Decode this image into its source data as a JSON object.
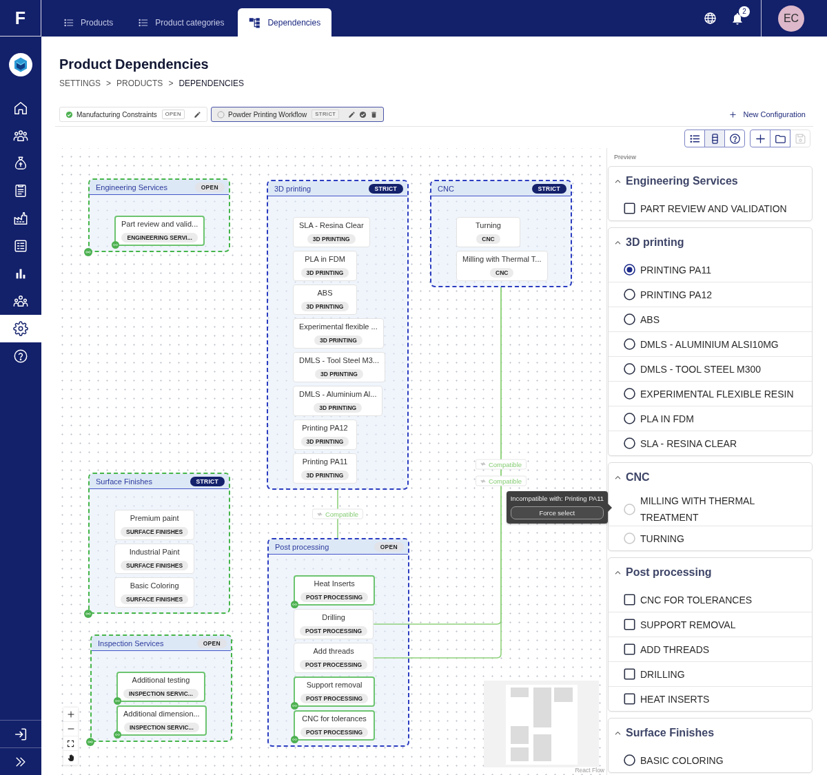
{
  "sidebar": {
    "brand": "F",
    "items": [
      {
        "selected": false
      },
      {
        "selected": false
      },
      {
        "selected": false
      },
      {
        "selected": false
      },
      {
        "selected": false
      },
      {
        "selected": false
      },
      {
        "selected": false
      },
      {
        "selected": false
      },
      {
        "selected": true
      },
      {
        "selected": false
      }
    ]
  },
  "topbar": {
    "tabs": [
      {
        "label": "Products",
        "selected": false
      },
      {
        "label": "Product categories",
        "selected": false
      },
      {
        "label": "Dependencies",
        "selected": true
      }
    ],
    "notifications": "2",
    "avatar": "EC"
  },
  "page": {
    "title": "Product Dependencies",
    "breadcrumb": [
      {
        "label": "SETTINGS",
        "current": false
      },
      {
        "label": "PRODUCTS",
        "separator": ">",
        "current": false
      },
      {
        "label": "DEPENDENCIES",
        "separator": ">",
        "current": true
      }
    ]
  },
  "configurations": {
    "items": [
      {
        "name": "Manufacturing Constraints",
        "mode": "OPEN",
        "active": true,
        "selected": false
      },
      {
        "name": "Powder Printing Workflow",
        "mode": "STRICT",
        "active": false,
        "selected": true
      }
    ],
    "new_configuration": "New Configuration"
  },
  "toolbar": {
    "views": [
      {
        "selected": false
      },
      {
        "selected": true
      },
      {
        "selected": false
      }
    ],
    "actions": [
      {
        "disabled": false
      },
      {
        "disabled": false
      },
      {
        "disabled": true
      }
    ]
  },
  "canvas": {
    "groups": [
      {
        "title": "Engineering Services",
        "mode": "OPEN",
        "strict": false,
        "color": "#45b549",
        "handle": true,
        "nodes": [
          {
            "name": "Part review and valid...",
            "category": "ENGINEERING SERVI...",
            "highlighted": true
          }
        ]
      },
      {
        "title": "3D printing",
        "mode": "STRICT",
        "strict": true,
        "color": "#2b3cc0",
        "handle": false,
        "nodes": [
          {
            "name": "SLA - Resina Clear",
            "category": "3D PRINTING",
            "highlighted": false
          },
          {
            "name": "PLA in FDM",
            "category": "3D PRINTING",
            "highlighted": false
          },
          {
            "name": "ABS",
            "category": "3D PRINTING",
            "highlighted": false
          },
          {
            "name": "Experimental flexible ...",
            "category": "3D PRINTING",
            "highlighted": false
          },
          {
            "name": "DMLS - Tool Steel M3...",
            "category": "3D PRINTING",
            "highlighted": false
          },
          {
            "name": "DMLS - Aluminium Al...",
            "category": "3D PRINTING",
            "highlighted": false
          },
          {
            "name": "Printing PA12",
            "category": "3D PRINTING",
            "highlighted": false
          },
          {
            "name": "Printing PA11",
            "category": "3D PRINTING",
            "highlighted": false
          }
        ]
      },
      {
        "title": "CNC",
        "mode": "STRICT",
        "strict": true,
        "color": "#2b3cc0",
        "handle": false,
        "nodes": [
          {
            "name": "Turning",
            "category": "CNC",
            "highlighted": false
          },
          {
            "name": "Milling with Thermal T...",
            "category": "CNC",
            "highlighted": false
          }
        ]
      },
      {
        "title": "Surface Finishes",
        "mode": "STRICT",
        "strict": true,
        "color": "#45b549",
        "handle": true,
        "nodes": [
          {
            "name": "Premium paint",
            "category": "SURFACE FINISHES",
            "highlighted": false
          },
          {
            "name": "Industrial Paint",
            "category": "SURFACE FINISHES",
            "highlighted": false
          },
          {
            "name": "Basic Coloring",
            "category": "SURFACE FINISHES",
            "highlighted": false
          }
        ]
      },
      {
        "title": "Inspection Services",
        "mode": "OPEN",
        "strict": false,
        "color": "#45b549",
        "handle": true,
        "nodes": [
          {
            "name": "Additional testing",
            "category": "INSPECTION SERVIC...",
            "highlighted": true
          },
          {
            "name": "Additional dimension...",
            "category": "INSPECTION SERVIC...",
            "highlighted": true
          }
        ]
      },
      {
        "title": "Post processing",
        "mode": "OPEN",
        "strict": false,
        "color": "#2b3cc0",
        "handle": false,
        "nodes": [
          {
            "name": "Heat Inserts",
            "category": "POST PROCESSING",
            "highlighted": true
          },
          {
            "name": "Drilling",
            "category": "POST PROCESSING",
            "highlighted": false
          },
          {
            "name": "Add threads",
            "category": "POST PROCESSING",
            "highlighted": false
          },
          {
            "name": "Support removal",
            "category": "POST PROCESSING",
            "highlighted": true
          },
          {
            "name": "CNC for tolerances",
            "category": "POST PROCESSING",
            "highlighted": true
          }
        ]
      }
    ],
    "edges": [
      {
        "label": "Compatible"
      },
      {
        "label": "Compatible"
      },
      {
        "label": "Compatible"
      }
    ],
    "attribution": "React Flow"
  },
  "preview": {
    "label": "Preview",
    "sections": [
      {
        "title": "Engineering Services",
        "expanded": true,
        "kind": "checkbox",
        "items": [
          {
            "label": "PART REVIEW AND VALIDATION",
            "checked": false
          }
        ]
      },
      {
        "title": "3D printing",
        "expanded": true,
        "kind": "radio",
        "items": [
          {
            "label": "PRINTING PA11",
            "selected": true
          },
          {
            "label": "PRINTING PA12",
            "selected": false
          },
          {
            "label": "ABS",
            "selected": false
          },
          {
            "label": "DMLS - ALUMINIUM ALSI10MG",
            "selected": false
          },
          {
            "label": "DMLS - TOOL STEEL M300",
            "selected": false
          },
          {
            "label": "EXPERIMENTAL FLEXIBLE RESIN",
            "selected": false
          },
          {
            "label": "PLA IN FDM",
            "selected": false
          },
          {
            "label": "SLA - RESINA CLEAR",
            "selected": false
          }
        ]
      },
      {
        "title": "CNC",
        "expanded": true,
        "kind": "radio",
        "items": [
          {
            "label": "MILLING WITH THERMAL TREATMENT",
            "selected": false,
            "disabled": true
          },
          {
            "label": "TURNING",
            "selected": false,
            "disabled": true
          }
        ]
      },
      {
        "title": "Post processing",
        "expanded": true,
        "kind": "checkbox",
        "items": [
          {
            "label": "CNC FOR TOLERANCES",
            "checked": false
          },
          {
            "label": "SUPPORT REMOVAL",
            "checked": false
          },
          {
            "label": "ADD THREADS",
            "checked": false
          },
          {
            "label": "DRILLING",
            "checked": false
          },
          {
            "label": "HEAT INSERTS",
            "checked": false
          }
        ]
      },
      {
        "title": "Surface Finishes",
        "expanded": true,
        "kind": "radio",
        "items": [
          {
            "label": "BASIC COLORING",
            "selected": false
          }
        ]
      }
    ]
  },
  "tooltip": {
    "message": "Incompatible with: Printing PA11",
    "action": "Force select"
  }
}
